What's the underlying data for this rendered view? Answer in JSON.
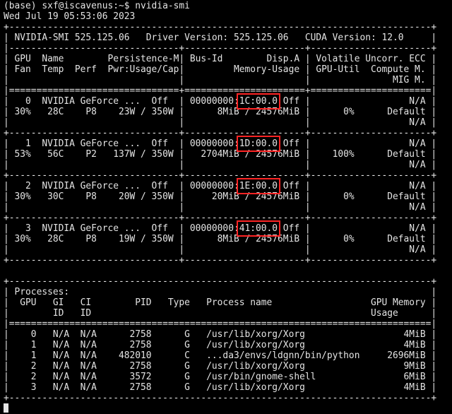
{
  "terminal": {
    "lines": [
      "(base) sxf@iscavenus:~$ nvidia-smi",
      "Wed Jul 19 05:53:06 2023",
      "+-----------------------------------------------------------------------------+",
      "| NVIDIA-SMI 525.125.06   Driver Version: 525.125.06   CUDA Version: 12.0     |",
      "|-------------------------------+----------------------+----------------------+",
      "| GPU  Name        Persistence-M| Bus-Id        Disp.A | Volatile Uncorr. ECC |",
      "| Fan  Temp  Perf  Pwr:Usage/Cap|         Memory-Usage | GPU-Util  Compute M. |",
      "|                               |                      |               MIG M. |",
      "|===============================+======================+======================|",
      "|   0  NVIDIA GeForce ...  Off  | 00000000:1C:00.0 Off |                  N/A |",
      "| 30%   28C    P8    23W / 350W |      8MiB / 24576MiB |      0%      Default |",
      "|                               |                      |                  N/A |",
      "+-------------------------------+----------------------+----------------------+",
      "|   1  NVIDIA GeForce ...  Off  | 00000000:1D:00.0 Off |                  N/A |",
      "| 53%   56C    P2   137W / 350W |   2704MiB / 24576MiB |    100%      Default |",
      "|                               |                      |                  N/A |",
      "+-------------------------------+----------------------+----------------------+",
      "|   2  NVIDIA GeForce ...  Off  | 00000000:1E:00.0 Off |                  N/A |",
      "| 30%   30C    P8    20W / 350W |     20MiB / 24576MiB |      0%      Default |",
      "|                               |                      |                  N/A |",
      "+-------------------------------+----------------------+----------------------+",
      "|   3  NVIDIA GeForce ...  Off  | 00000000:41:00.0 Off |                  N/A |",
      "| 30%   28C    P8    19W / 350W |      8MiB / 24576MiB |      0%      Default |",
      "|                               |                      |                  N/A |",
      "+-------------------------------+----------------------+----------------------+",
      "",
      "+-----------------------------------------------------------------------------+",
      "| Processes:                                                                  |",
      "|  GPU   GI   CI        PID   Type   Process name                  GPU Memory |",
      "|        ID   ID                                                   Usage      |",
      "|=============================================================================|",
      "|    0   N/A  N/A      2758      G   /usr/lib/xorg/Xorg                  4MiB |",
      "|    1   N/A  N/A      2758      G   /usr/lib/xorg/Xorg                  4MiB |",
      "|    1   N/A  N/A    482010      C   ...da3/envs/ldgnn/bin/python     2696MiB |",
      "|    2   N/A  N/A      2758      G   /usr/lib/xorg/Xorg                  9MiB |",
      "|    2   N/A  N/A      3572      G   /usr/bin/gnome-shell                6MiB |",
      "|    3   N/A  N/A      2758      G   /usr/lib/xorg/Xorg                  4MiB |",
      "+-----------------------------------------------------------------------------+"
    ],
    "highlight_text": [
      "1C:00.0",
      "1D:00.0",
      "1E:00.0",
      "41:00.0"
    ],
    "colors": {
      "background": "#000000",
      "text": "#e4e4e4",
      "highlight_box": "#ff2424"
    }
  }
}
